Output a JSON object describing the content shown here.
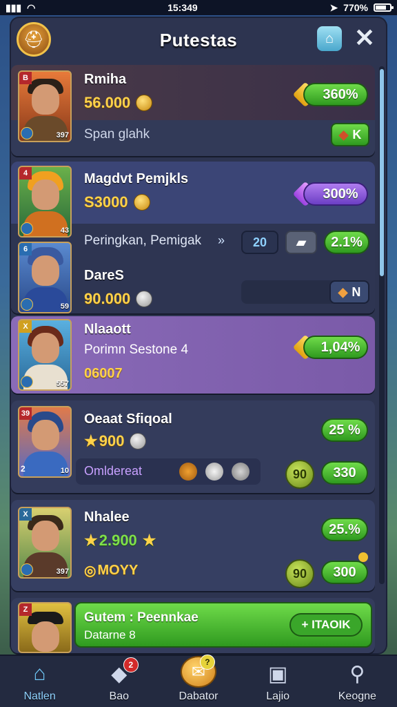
{
  "status": {
    "time": "15:349",
    "battery": "770%"
  },
  "header": {
    "title": "Putestas"
  },
  "cards": [
    {
      "badge": "B",
      "level": "397",
      "name": "Rmiha",
      "amount": "56.000",
      "percent": "360%",
      "sub": "Span glahk",
      "action": "K"
    },
    {
      "badge": "4",
      "level": "43",
      "name": "Magdvt Pemjkls",
      "amount": "S3000",
      "percent": "300%"
    },
    {
      "badge": "6",
      "level": "59",
      "name": "DareS",
      "amount": "90.000",
      "sub": "Peringkan, Pemigak",
      "counter": "20",
      "percent": "2.1%",
      "action": "N"
    },
    {
      "badge": "X",
      "level": "557",
      "name": "Nlaaott",
      "sub": "Porimn Sestone 4",
      "amount": "06007",
      "percent": "1,04%"
    },
    {
      "badge": "39",
      "level": "10",
      "rank_num": "2",
      "name": "Oeaat Sfiqoal",
      "amount": "900",
      "percent": "25 %",
      "sub": "Omldereat",
      "round": "90",
      "value": "330"
    },
    {
      "badge": "X",
      "level": "397",
      "name": "Nhalee",
      "amount": "2.900",
      "percent": "25.%",
      "sub": "MOYY",
      "round": "90",
      "value": "300"
    },
    {
      "badge": "Z",
      "name": "Gutem : Peennkae",
      "sub": "Datarne 8",
      "button": "+ ITAOIK"
    }
  ],
  "nav": [
    {
      "label": "Natlen",
      "icon": "home-icon"
    },
    {
      "label": "Bao",
      "icon": "gift-icon",
      "badge": "2"
    },
    {
      "label": "Dabator",
      "icon": "mail-icon",
      "badge": "?"
    },
    {
      "label": "Lajio",
      "icon": "bag-icon"
    },
    {
      "label": "Keogne",
      "icon": "search-icon"
    }
  ],
  "colors": {
    "accent_green": "#2f9a1f",
    "accent_purple": "#6b3fc4",
    "panel": "#2d3450",
    "highlight": "#8a6bb8"
  }
}
